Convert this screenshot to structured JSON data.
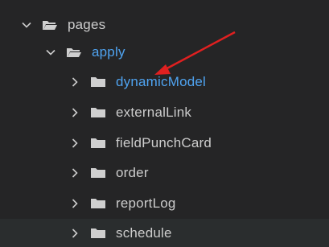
{
  "explorer": {
    "items": [
      {
        "label": "pages",
        "state": "expanded",
        "icon": "folder-open-icon"
      },
      {
        "label": "apply",
        "state": "expanded",
        "icon": "folder-open-icon"
      },
      {
        "label": "dynamicModel",
        "state": "collapsed",
        "icon": "folder-icon"
      },
      {
        "label": "externalLink",
        "state": "collapsed",
        "icon": "folder-icon"
      },
      {
        "label": "fieldPunchCard",
        "state": "collapsed",
        "icon": "folder-icon"
      },
      {
        "label": "order",
        "state": "collapsed",
        "icon": "folder-icon"
      },
      {
        "label": "reportLog",
        "state": "collapsed",
        "icon": "folder-icon"
      },
      {
        "label": "schedule",
        "state": "collapsed",
        "icon": "folder-icon"
      }
    ]
  },
  "colors": {
    "background": "#252526",
    "text": "#cccccc",
    "active_text": "#4fa3f0",
    "annotation_arrow": "#e02020",
    "hover_row": "#2a2d2e"
  }
}
